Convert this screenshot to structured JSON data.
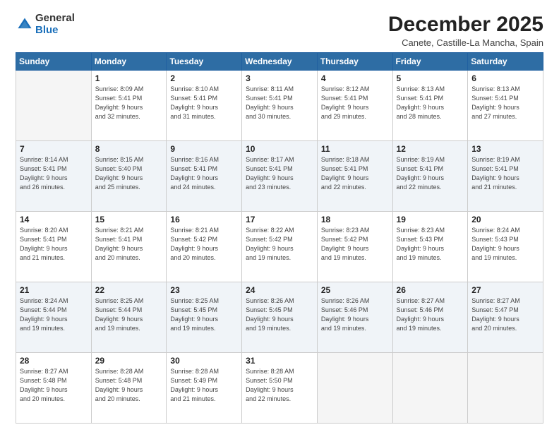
{
  "header": {
    "logo_general": "General",
    "logo_blue": "Blue",
    "month_title": "December 2025",
    "location": "Canete, Castille-La Mancha, Spain"
  },
  "weekdays": [
    "Sunday",
    "Monday",
    "Tuesday",
    "Wednesday",
    "Thursday",
    "Friday",
    "Saturday"
  ],
  "weeks": [
    [
      {
        "day": "",
        "sunrise": "",
        "sunset": "",
        "daylight": ""
      },
      {
        "day": "1",
        "sunrise": "Sunrise: 8:09 AM",
        "sunset": "Sunset: 5:41 PM",
        "daylight": "Daylight: 9 hours and 32 minutes."
      },
      {
        "day": "2",
        "sunrise": "Sunrise: 8:10 AM",
        "sunset": "Sunset: 5:41 PM",
        "daylight": "Daylight: 9 hours and 31 minutes."
      },
      {
        "day": "3",
        "sunrise": "Sunrise: 8:11 AM",
        "sunset": "Sunset: 5:41 PM",
        "daylight": "Daylight: 9 hours and 30 minutes."
      },
      {
        "day": "4",
        "sunrise": "Sunrise: 8:12 AM",
        "sunset": "Sunset: 5:41 PM",
        "daylight": "Daylight: 9 hours and 29 minutes."
      },
      {
        "day": "5",
        "sunrise": "Sunrise: 8:13 AM",
        "sunset": "Sunset: 5:41 PM",
        "daylight": "Daylight: 9 hours and 28 minutes."
      },
      {
        "day": "6",
        "sunrise": "Sunrise: 8:13 AM",
        "sunset": "Sunset: 5:41 PM",
        "daylight": "Daylight: 9 hours and 27 minutes."
      }
    ],
    [
      {
        "day": "7",
        "sunrise": "Sunrise: 8:14 AM",
        "sunset": "Sunset: 5:41 PM",
        "daylight": "Daylight: 9 hours and 26 minutes."
      },
      {
        "day": "8",
        "sunrise": "Sunrise: 8:15 AM",
        "sunset": "Sunset: 5:40 PM",
        "daylight": "Daylight: 9 hours and 25 minutes."
      },
      {
        "day": "9",
        "sunrise": "Sunrise: 8:16 AM",
        "sunset": "Sunset: 5:41 PM",
        "daylight": "Daylight: 9 hours and 24 minutes."
      },
      {
        "day": "10",
        "sunrise": "Sunrise: 8:17 AM",
        "sunset": "Sunset: 5:41 PM",
        "daylight": "Daylight: 9 hours and 23 minutes."
      },
      {
        "day": "11",
        "sunrise": "Sunrise: 8:18 AM",
        "sunset": "Sunset: 5:41 PM",
        "daylight": "Daylight: 9 hours and 22 minutes."
      },
      {
        "day": "12",
        "sunrise": "Sunrise: 8:19 AM",
        "sunset": "Sunset: 5:41 PM",
        "daylight": "Daylight: 9 hours and 22 minutes."
      },
      {
        "day": "13",
        "sunrise": "Sunrise: 8:19 AM",
        "sunset": "Sunset: 5:41 PM",
        "daylight": "Daylight: 9 hours and 21 minutes."
      }
    ],
    [
      {
        "day": "14",
        "sunrise": "Sunrise: 8:20 AM",
        "sunset": "Sunset: 5:41 PM",
        "daylight": "Daylight: 9 hours and 21 minutes."
      },
      {
        "day": "15",
        "sunrise": "Sunrise: 8:21 AM",
        "sunset": "Sunset: 5:41 PM",
        "daylight": "Daylight: 9 hours and 20 minutes."
      },
      {
        "day": "16",
        "sunrise": "Sunrise: 8:21 AM",
        "sunset": "Sunset: 5:42 PM",
        "daylight": "Daylight: 9 hours and 20 minutes."
      },
      {
        "day": "17",
        "sunrise": "Sunrise: 8:22 AM",
        "sunset": "Sunset: 5:42 PM",
        "daylight": "Daylight: 9 hours and 19 minutes."
      },
      {
        "day": "18",
        "sunrise": "Sunrise: 8:23 AM",
        "sunset": "Sunset: 5:42 PM",
        "daylight": "Daylight: 9 hours and 19 minutes."
      },
      {
        "day": "19",
        "sunrise": "Sunrise: 8:23 AM",
        "sunset": "Sunset: 5:43 PM",
        "daylight": "Daylight: 9 hours and 19 minutes."
      },
      {
        "day": "20",
        "sunrise": "Sunrise: 8:24 AM",
        "sunset": "Sunset: 5:43 PM",
        "daylight": "Daylight: 9 hours and 19 minutes."
      }
    ],
    [
      {
        "day": "21",
        "sunrise": "Sunrise: 8:24 AM",
        "sunset": "Sunset: 5:44 PM",
        "daylight": "Daylight: 9 hours and 19 minutes."
      },
      {
        "day": "22",
        "sunrise": "Sunrise: 8:25 AM",
        "sunset": "Sunset: 5:44 PM",
        "daylight": "Daylight: 9 hours and 19 minutes."
      },
      {
        "day": "23",
        "sunrise": "Sunrise: 8:25 AM",
        "sunset": "Sunset: 5:45 PM",
        "daylight": "Daylight: 9 hours and 19 minutes."
      },
      {
        "day": "24",
        "sunrise": "Sunrise: 8:26 AM",
        "sunset": "Sunset: 5:45 PM",
        "daylight": "Daylight: 9 hours and 19 minutes."
      },
      {
        "day": "25",
        "sunrise": "Sunrise: 8:26 AM",
        "sunset": "Sunset: 5:46 PM",
        "daylight": "Daylight: 9 hours and 19 minutes."
      },
      {
        "day": "26",
        "sunrise": "Sunrise: 8:27 AM",
        "sunset": "Sunset: 5:46 PM",
        "daylight": "Daylight: 9 hours and 19 minutes."
      },
      {
        "day": "27",
        "sunrise": "Sunrise: 8:27 AM",
        "sunset": "Sunset: 5:47 PM",
        "daylight": "Daylight: 9 hours and 20 minutes."
      }
    ],
    [
      {
        "day": "28",
        "sunrise": "Sunrise: 8:27 AM",
        "sunset": "Sunset: 5:48 PM",
        "daylight": "Daylight: 9 hours and 20 minutes."
      },
      {
        "day": "29",
        "sunrise": "Sunrise: 8:28 AM",
        "sunset": "Sunset: 5:48 PM",
        "daylight": "Daylight: 9 hours and 20 minutes."
      },
      {
        "day": "30",
        "sunrise": "Sunrise: 8:28 AM",
        "sunset": "Sunset: 5:49 PM",
        "daylight": "Daylight: 9 hours and 21 minutes."
      },
      {
        "day": "31",
        "sunrise": "Sunrise: 8:28 AM",
        "sunset": "Sunset: 5:50 PM",
        "daylight": "Daylight: 9 hours and 22 minutes."
      },
      {
        "day": "",
        "sunrise": "",
        "sunset": "",
        "daylight": ""
      },
      {
        "day": "",
        "sunrise": "",
        "sunset": "",
        "daylight": ""
      },
      {
        "day": "",
        "sunrise": "",
        "sunset": "",
        "daylight": ""
      }
    ]
  ]
}
